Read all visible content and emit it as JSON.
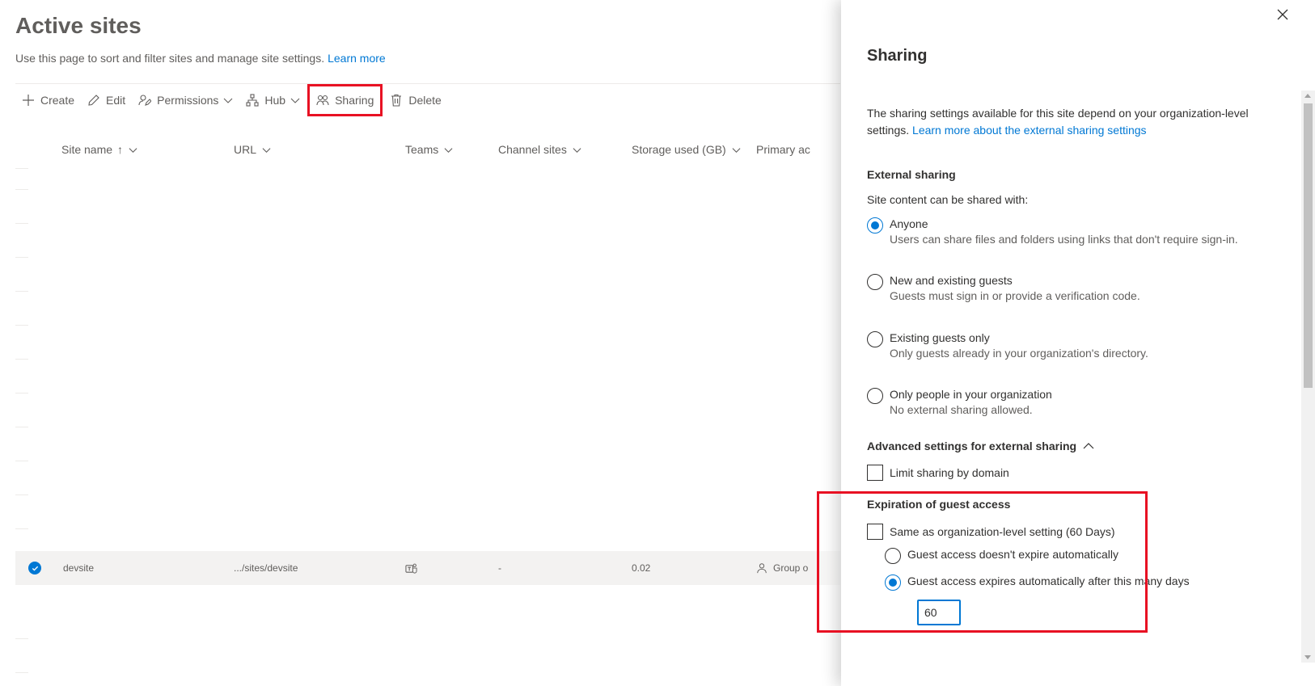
{
  "page": {
    "title": "Active sites",
    "description": "Use this page to sort and filter sites and manage site settings.",
    "learn_more": "Learn more"
  },
  "toolbar": {
    "create": "Create",
    "edit": "Edit",
    "permissions": "Permissions",
    "hub": "Hub",
    "sharing": "Sharing",
    "delete": "Delete"
  },
  "columns": {
    "site_name": "Site name",
    "site_name_sort": "↑",
    "url": "URL",
    "teams": "Teams",
    "channel_sites": "Channel sites",
    "storage": "Storage used (GB)",
    "primary_admin": "Primary ac"
  },
  "row": {
    "site_name": "devsite",
    "url": ".../sites/devsite",
    "channel_sites": "-",
    "storage": "0.02",
    "primary_admin": "Group o"
  },
  "panel": {
    "title": "Sharing",
    "intro": "The sharing settings available for this site depend on your organization-level settings.",
    "intro_link": "Learn more about the external sharing settings",
    "external_sharing_label": "External sharing",
    "shared_with_label": "Site content can be shared with:",
    "options": [
      {
        "label": "Anyone",
        "sub": "Users can share files and folders using links that don't require sign-in.",
        "checked": true
      },
      {
        "label": "New and existing guests",
        "sub": "Guests must sign in or provide a verification code.",
        "checked": false
      },
      {
        "label": "Existing guests only",
        "sub": "Only guests already in your organization's directory.",
        "checked": false
      },
      {
        "label": "Only people in your organization",
        "sub": "No external sharing allowed.",
        "checked": false
      }
    ],
    "advanced_label": "Advanced settings for external sharing",
    "limit_domain": "Limit sharing by domain",
    "expiration_label": "Expiration of guest access",
    "same_as_org": "Same as organization-level setting (60 Days)",
    "no_expire": "Guest access doesn't expire automatically",
    "expires_after": "Guest access expires automatically after this many days",
    "days_value": "60"
  },
  "colors": {
    "accent": "#0078d4",
    "highlight_border": "#e81123",
    "text": "#323130",
    "muted_text": "#605e5c"
  }
}
